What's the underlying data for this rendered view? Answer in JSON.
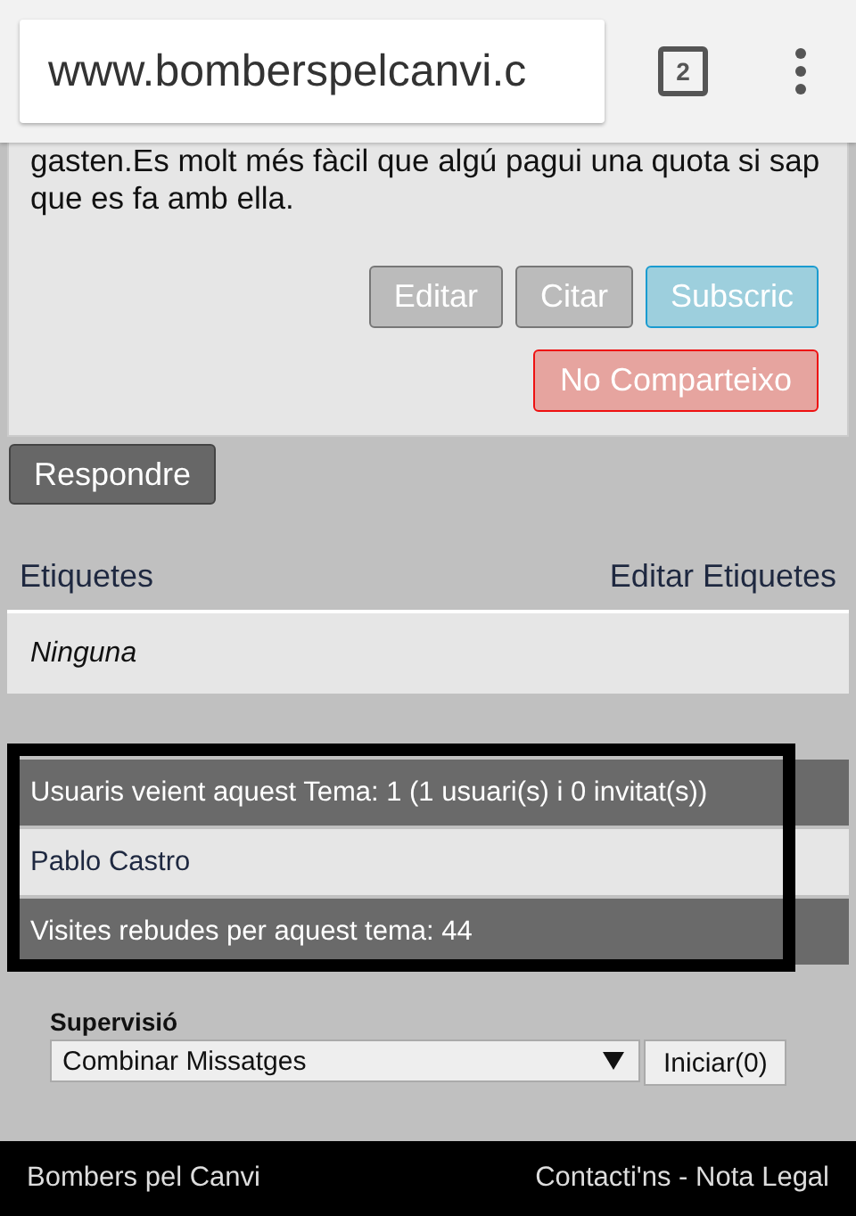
{
  "browser": {
    "url": "www.bomberspelcanvi.c",
    "tab_count": "2"
  },
  "post": {
    "text": "gasten.Es molt més fàcil que algú pagui una quota si sap que es fa amb ella.",
    "buttons": [
      {
        "label": "Editar",
        "kind": "grey"
      },
      {
        "label": "Citar",
        "kind": "grey"
      },
      {
        "label": "Subscric",
        "kind": "blue"
      }
    ],
    "share_button": "No Comparteixo"
  },
  "reply_button": "Respondre",
  "tags": {
    "title": "Etiquetes",
    "edit_link": "Editar Etiquetes",
    "value": "Ninguna"
  },
  "viewers": {
    "header": "Usuaris veient aquest Tema: 1 (1 usuari(s) i 0 invitat(s))",
    "users": [
      "Pablo Castro"
    ],
    "visits": "Visites rebudes per aquest tema: 44"
  },
  "moderation": {
    "label": "Supervisió",
    "select": "Combinar Missatges",
    "button": "Iniciar(0)"
  },
  "footer": {
    "left": "Bombers pel Canvi",
    "right": "Contacti'ns - Nota Legal"
  }
}
